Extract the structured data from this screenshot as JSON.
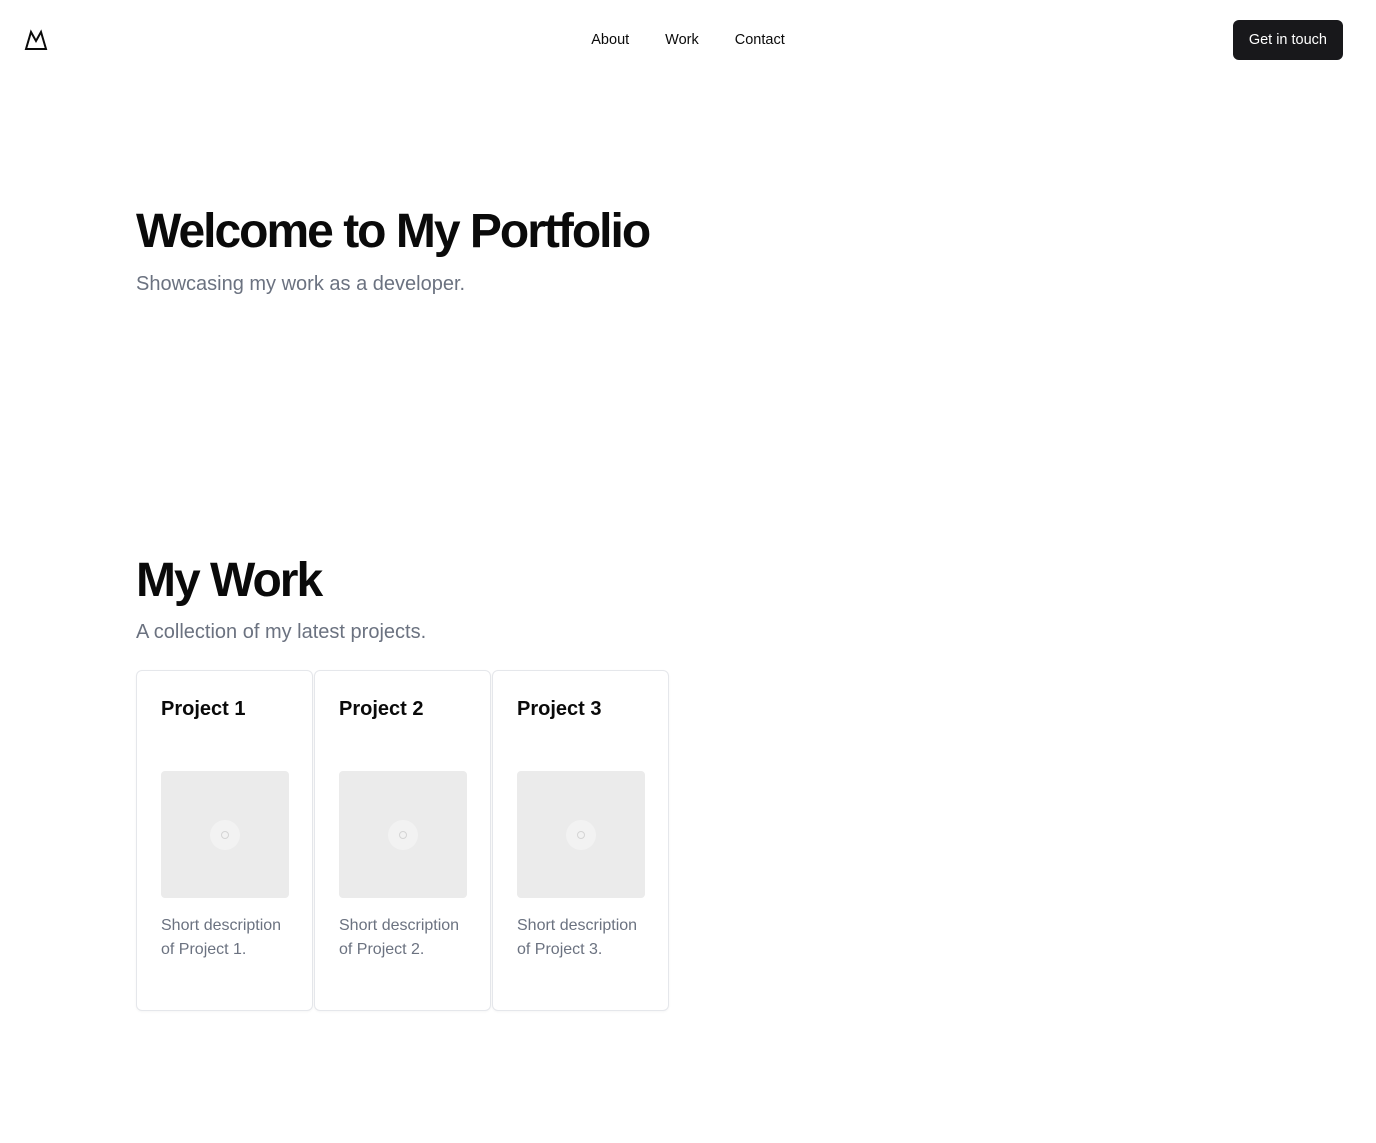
{
  "header": {
    "logo_icon": "mountain-logo-icon",
    "nav": [
      {
        "label": "About"
      },
      {
        "label": "Work"
      },
      {
        "label": "Contact"
      }
    ],
    "cta_label": "Get in touch"
  },
  "hero": {
    "title": "Welcome to My Portfolio",
    "subtitle": "Showcasing my work as a developer."
  },
  "work": {
    "title": "My Work",
    "subtitle": "A collection of my latest projects.",
    "projects": [
      {
        "title": "Project 1",
        "description": "Short description of Project 1.",
        "image_icon": "image-placeholder-icon"
      },
      {
        "title": "Project 2",
        "description": "Short description of Project 2.",
        "image_icon": "image-placeholder-icon"
      },
      {
        "title": "Project 3",
        "description": "Short description of Project 3.",
        "image_icon": "image-placeholder-icon"
      }
    ]
  },
  "colors": {
    "cta_background": "#18181b",
    "muted_text": "#6b7280",
    "card_border": "#e5e7eb",
    "placeholder_bg": "#ebebeb"
  }
}
